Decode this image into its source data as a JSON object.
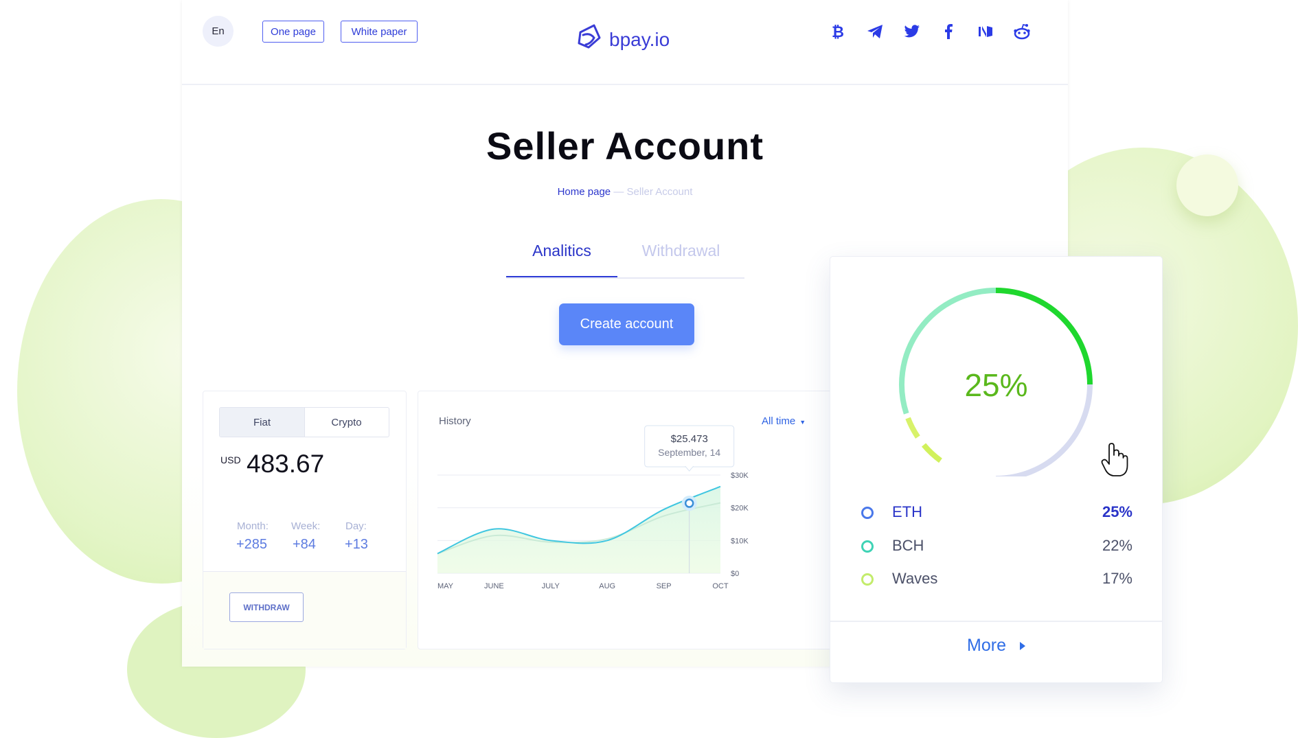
{
  "header": {
    "lang": "En",
    "one_page": "One page",
    "white_paper": "White paper",
    "logo_text": "bpay.io",
    "social_icons": [
      "bitcoin-icon",
      "telegram-icon",
      "twitter-icon",
      "facebook-icon",
      "medium-icon",
      "reddit-icon"
    ]
  },
  "page": {
    "title": "Seller Account",
    "breadcrumb_home": "Home page",
    "breadcrumb_sep": "—",
    "breadcrumb_current": "Seller Account"
  },
  "tabs": [
    {
      "label": "Analitics",
      "active": true
    },
    {
      "label": "Withdrawal",
      "active": false
    }
  ],
  "create_button": "Create account",
  "balance": {
    "segments": [
      "Fiat",
      "Crypto"
    ],
    "selected": "Fiat",
    "currency": "USD",
    "amount": "483.67",
    "stats": [
      {
        "label": "Month:",
        "value": "+285"
      },
      {
        "label": "Week:",
        "value": "+84"
      },
      {
        "label": "Day:",
        "value": "+13"
      }
    ],
    "withdraw_label": "WITHDRAW"
  },
  "history": {
    "title": "History",
    "filter": "All time"
  },
  "chart_data": {
    "type": "area",
    "x": [
      "MAY",
      "JUNE",
      "JULY",
      "AUG",
      "SEP",
      "OCT"
    ],
    "yticks": [
      "$30K",
      "$20K",
      "$10K",
      "$0"
    ],
    "ylim": [
      0,
      30000
    ],
    "series": [
      {
        "values": [
          6000,
          13500,
          10000,
          10000,
          19500,
          26500
        ]
      },
      {
        "values": [
          6000,
          11500,
          9500,
          10500,
          17500,
          21500
        ]
      }
    ],
    "tooltip": {
      "value": "$25.473",
      "date": "September, 14"
    },
    "grid": true
  },
  "donut": {
    "percent_label": "25%",
    "segments": [
      {
        "name": "ETH",
        "value": 25,
        "label": "25%",
        "color": "#1fd72e"
      },
      {
        "name": "BCH",
        "value": 22,
        "label": "22%",
        "color": "#93ecc3"
      },
      {
        "name": "Waves",
        "value": 17,
        "label": "17%",
        "color": "#d8f26a"
      }
    ],
    "remainder_color": "#d7dbf0",
    "legend_colors": {
      "ETH": "#4a78ea",
      "BCH": "#3fd3b5",
      "Waves": "#c3ec6b"
    },
    "more_label": "More"
  }
}
